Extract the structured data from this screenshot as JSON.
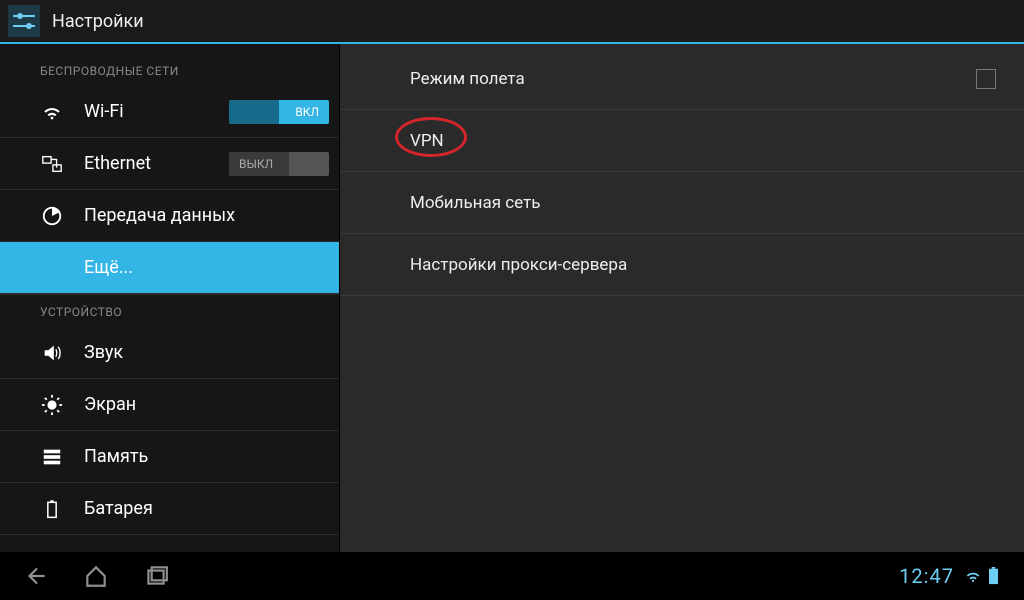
{
  "colors": {
    "accent": "#33b5e5",
    "highlight_ring": "#d4262a"
  },
  "action_bar": {
    "title": "Настройки"
  },
  "sidebar": {
    "sections": [
      {
        "header": "БЕСПРОВОДНЫЕ СЕТИ",
        "items": [
          {
            "id": "wifi",
            "label": "Wi-Fi",
            "toggle": {
              "state": "on",
              "text": "ВКЛ"
            },
            "selected": false
          },
          {
            "id": "ethernet",
            "label": "Ethernet",
            "toggle": {
              "state": "off",
              "text": "ВЫКЛ"
            },
            "selected": false
          },
          {
            "id": "data",
            "label": "Передача данных",
            "selected": false
          },
          {
            "id": "more",
            "label": "Ещё...",
            "selected": true
          }
        ]
      },
      {
        "header": "УСТРОЙСТВО",
        "items": [
          {
            "id": "sound",
            "label": "Звук"
          },
          {
            "id": "display",
            "label": "Экран"
          },
          {
            "id": "storage",
            "label": "Память"
          },
          {
            "id": "battery",
            "label": "Батарея"
          }
        ]
      }
    ]
  },
  "content": {
    "items": [
      {
        "id": "airplane",
        "label": "Режим полета",
        "checkbox": true,
        "checked": false
      },
      {
        "id": "vpn",
        "label": "VPN",
        "highlighted": true
      },
      {
        "id": "mobile",
        "label": "Мобильная сеть"
      },
      {
        "id": "proxy",
        "label": "Настройки прокси-сервера"
      }
    ]
  },
  "status_bar": {
    "clock": "12:47"
  }
}
